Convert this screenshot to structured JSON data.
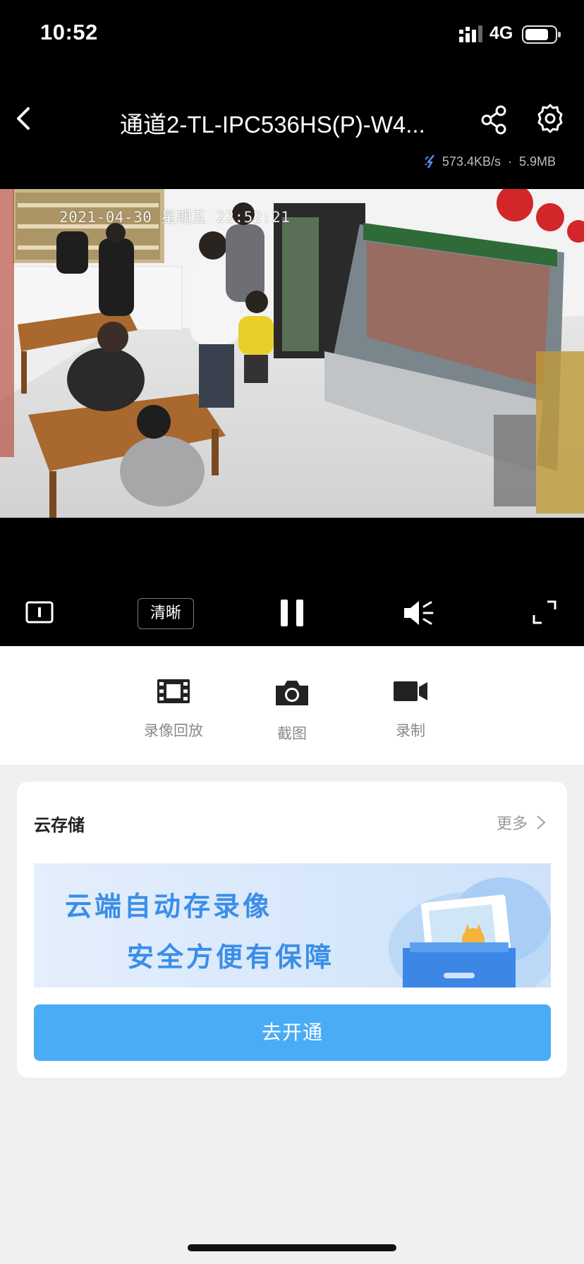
{
  "status_bar": {
    "time": "10:52",
    "network": "4G"
  },
  "nav": {
    "title": "通道2-TL-IPC536HS(P)-W4..."
  },
  "stats": {
    "speed": "573.4KB/s",
    "separator": "·",
    "size": "5.9MB"
  },
  "video": {
    "osd_timestamp": "2021-04-30 星期五 22:52:21"
  },
  "controls": {
    "quality_label": "清晰"
  },
  "actions": [
    {
      "label": "录像回放",
      "icon": "film-icon"
    },
    {
      "label": "截图",
      "icon": "camera-icon"
    },
    {
      "label": "录制",
      "icon": "video-camera-icon"
    }
  ],
  "cloud_card": {
    "title": "云存储",
    "more_label": "更多",
    "banner_line1": "云端自动存录像",
    "banner_line2": "安全方便有保障",
    "button_label": "去开通"
  },
  "colors": {
    "accent_button": "#4aacf5",
    "banner_text": "#3b8ee8"
  }
}
